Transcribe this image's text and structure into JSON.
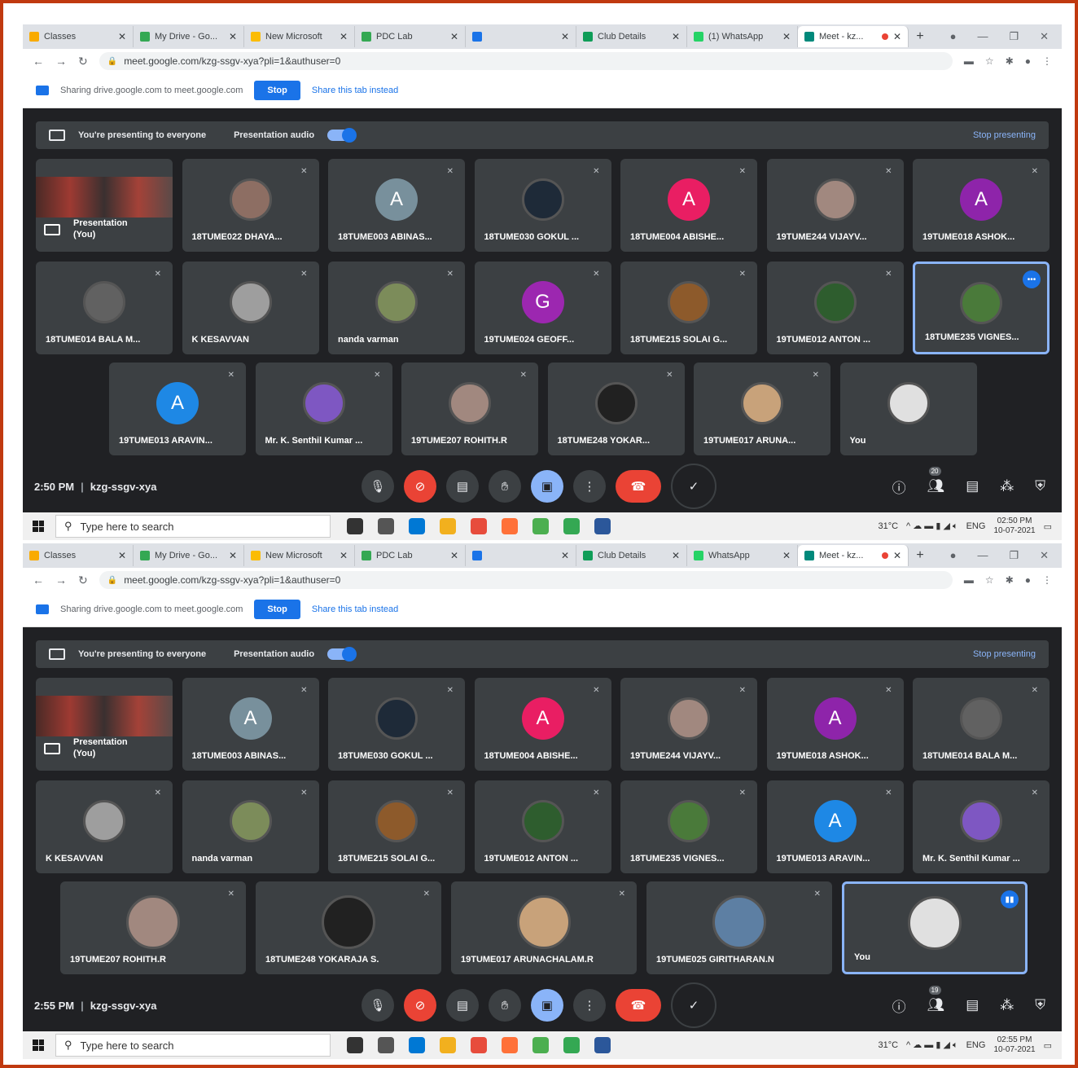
{
  "screens": [
    {
      "tabs": [
        {
          "title": "Classes",
          "color": "#f9ab00"
        },
        {
          "title": "My Drive - Go...",
          "color": "#34a853"
        },
        {
          "title": "New Microsoft",
          "color": "#fbbc04"
        },
        {
          "title": "PDC Lab",
          "color": "#34a853"
        },
        {
          "title": "",
          "color": "#1a73e8"
        },
        {
          "title": "Club Details",
          "color": "#0f9d58"
        },
        {
          "title": "(1) WhatsApp",
          "color": "#25d366"
        },
        {
          "title": "Meet - kz...",
          "color": "#00897b"
        }
      ],
      "url": "meet.google.com/kzg-ssgv-xya?pli=1&authuser=0",
      "share": {
        "text": "Sharing drive.google.com to meet.google.com",
        "stop": "Stop",
        "switch": "Share this tab instead"
      },
      "banner": {
        "presenting": "You're presenting to everyone",
        "audio": "Presentation audio",
        "stop": "Stop presenting"
      },
      "presentation": {
        "label": "Presentation",
        "you": "(You)"
      },
      "participants": [
        {
          "name": "18TUME022 DHAYA...",
          "avatar": "",
          "color": "#8d6e63"
        },
        {
          "name": "18TUME003 ABINAS...",
          "avatar": "A",
          "color": "#78909c"
        },
        {
          "name": "18TUME030 GOKUL ...",
          "avatar": "",
          "color": "#1e2a38"
        },
        {
          "name": "18TUME004 ABISHE...",
          "avatar": "A",
          "color": "#e91e63"
        },
        {
          "name": "19TUME244 VIJAYV...",
          "avatar": "",
          "color": "#a1887f"
        },
        {
          "name": "19TUME018 ASHOK...",
          "avatar": "A",
          "color": "#8e24aa"
        },
        {
          "name": "18TUME014 BALA M...",
          "avatar": "",
          "color": "#616161"
        },
        {
          "name": "K KESAVVAN",
          "avatar": "",
          "color": "#9e9e9e"
        },
        {
          "name": "nanda varman",
          "avatar": "",
          "color": "#7c8c5a"
        },
        {
          "name": "19TUME024 GEOFF...",
          "avatar": "G",
          "color": "#9c27b0"
        },
        {
          "name": "18TUME215 SOLAI G...",
          "avatar": "",
          "color": "#8d5a2b"
        },
        {
          "name": "19TUME012 ANTON ...",
          "avatar": "",
          "color": "#2e5d2e"
        },
        {
          "name": "18TUME235 VIGNES...",
          "avatar": "",
          "color": "#4a7a3a"
        },
        {
          "name": "19TUME013 ARAVIN...",
          "avatar": "A",
          "color": "#1e88e5"
        },
        {
          "name": "Mr. K. Senthil Kumar ...",
          "avatar": "",
          "color": "#7e57c2"
        },
        {
          "name": "19TUME207 ROHITH.R",
          "avatar": "",
          "color": "#a1887f"
        },
        {
          "name": "18TUME248 YOKAR...",
          "avatar": "",
          "color": "#212121"
        },
        {
          "name": "19TUME017 ARUNA...",
          "avatar": "",
          "color": "#c8a27a"
        },
        {
          "name": "You",
          "avatar": "",
          "color": "#e0e0e0"
        }
      ],
      "meeting": {
        "time": "2:50 PM",
        "code": "kzg-ssgv-xya",
        "people_count": "20"
      },
      "taskbar": {
        "search": "Type here to search",
        "temp": "31°C",
        "lang": "ENG",
        "time": "02:50 PM",
        "date": "10-07-2021"
      }
    },
    {
      "tabs": [
        {
          "title": "Classes",
          "color": "#f9ab00"
        },
        {
          "title": "My Drive - Go...",
          "color": "#34a853"
        },
        {
          "title": "New Microsoft",
          "color": "#fbbc04"
        },
        {
          "title": "PDC Lab",
          "color": "#34a853"
        },
        {
          "title": "",
          "color": "#1a73e8"
        },
        {
          "title": "Club Details",
          "color": "#0f9d58"
        },
        {
          "title": "WhatsApp",
          "color": "#25d366"
        },
        {
          "title": "Meet - kz...",
          "color": "#00897b"
        }
      ],
      "url": "meet.google.com/kzg-ssgv-xya?pli=1&authuser=0",
      "share": {
        "text": "Sharing drive.google.com to meet.google.com",
        "stop": "Stop",
        "switch": "Share this tab instead"
      },
      "banner": {
        "presenting": "You're presenting to everyone",
        "audio": "Presentation audio",
        "stop": "Stop presenting"
      },
      "presentation": {
        "label": "Presentation",
        "you": "(You)"
      },
      "participants": [
        {
          "name": "18TUME003 ABINAS...",
          "avatar": "A",
          "color": "#78909c"
        },
        {
          "name": "18TUME030 GOKUL ...",
          "avatar": "",
          "color": "#1e2a38"
        },
        {
          "name": "18TUME004 ABISHE...",
          "avatar": "A",
          "color": "#e91e63"
        },
        {
          "name": "19TUME244 VIJAYV...",
          "avatar": "",
          "color": "#a1887f"
        },
        {
          "name": "19TUME018 ASHOK...",
          "avatar": "A",
          "color": "#8e24aa"
        },
        {
          "name": "18TUME014 BALA M...",
          "avatar": "",
          "color": "#616161"
        },
        {
          "name": "K KESAVVAN",
          "avatar": "",
          "color": "#9e9e9e"
        },
        {
          "name": "nanda varman",
          "avatar": "",
          "color": "#7c8c5a"
        },
        {
          "name": "18TUME215 SOLAI G...",
          "avatar": "",
          "color": "#8d5a2b"
        },
        {
          "name": "19TUME012 ANTON ...",
          "avatar": "",
          "color": "#2e5d2e"
        },
        {
          "name": "18TUME235 VIGNES...",
          "avatar": "",
          "color": "#4a7a3a"
        },
        {
          "name": "19TUME013 ARAVIN...",
          "avatar": "A",
          "color": "#1e88e5"
        },
        {
          "name": "Mr. K. Senthil Kumar ...",
          "avatar": "",
          "color": "#7e57c2"
        },
        {
          "name": "19TUME207 ROHITH.R",
          "avatar": "",
          "color": "#a1887f"
        },
        {
          "name": "18TUME248 YOKARAJA S.",
          "avatar": "",
          "color": "#212121"
        },
        {
          "name": "19TUME017 ARUNACHALAM.R",
          "avatar": "",
          "color": "#c8a27a"
        },
        {
          "name": "19TUME025 GIRITHARAN.N",
          "avatar": "",
          "color": "#5d7fa3"
        },
        {
          "name": "You",
          "avatar": "",
          "color": "#e0e0e0"
        }
      ],
      "meeting": {
        "time": "2:55 PM",
        "code": "kzg-ssgv-xya",
        "people_count": "19"
      },
      "taskbar": {
        "search": "Type here to search",
        "temp": "31°C",
        "lang": "ENG",
        "time": "02:55 PM",
        "date": "10-07-2021"
      }
    }
  ]
}
